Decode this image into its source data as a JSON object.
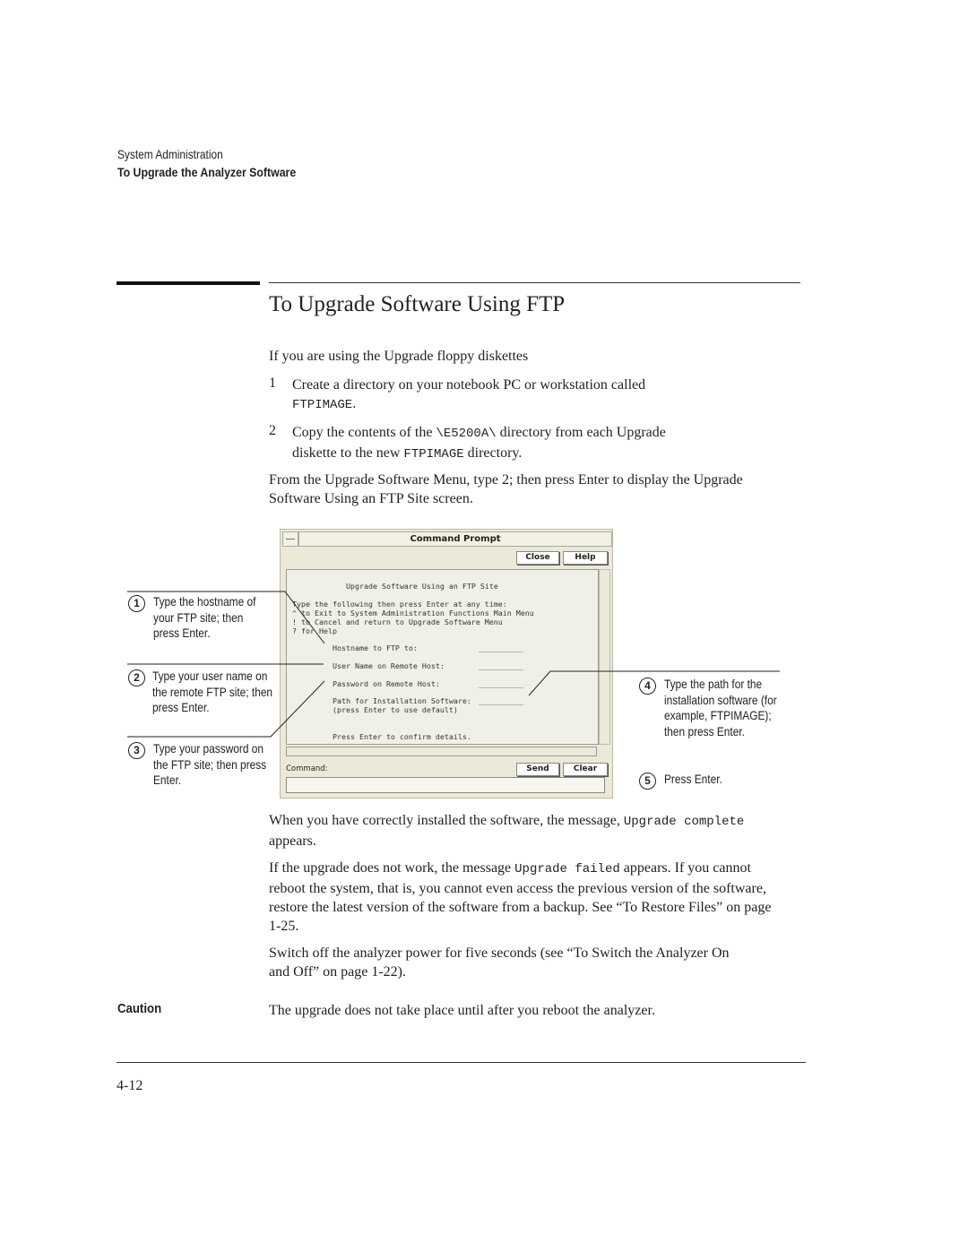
{
  "header": {
    "section": "System Administration",
    "subsection": "To Upgrade the Analyzer Software"
  },
  "title": "To Upgrade Software Using FTP",
  "intro": "If you are using the Upgrade floppy diskettes",
  "steps": [
    {
      "num": "1",
      "text_a": "Create a directory on your notebook PC or workstation called",
      "code": "FTPIMAGE",
      "text_b": "."
    },
    {
      "num": "2",
      "text_a": "Copy the contents of the ",
      "code": "\\E5200A\\",
      "text_b": " directory from each Upgrade",
      "text_c": "diskette to the new ",
      "code2": "FTPIMAGE",
      "text_d": " directory."
    }
  ],
  "para1": "From the Upgrade Software Menu, type 2; then press Enter to display the Upgrade Software Using an FTP Site screen.",
  "window": {
    "title": "Command Prompt",
    "close": "Close",
    "help": "Help",
    "heading": "Upgrade Software Using an FTP Site",
    "lines": [
      "Type the following then press Enter at any time:",
      "^ to Exit to System Administration Functions Main Menu",
      "! to Cancel and return to Upgrade Software Menu",
      "? for Help"
    ],
    "fields": [
      {
        "label": "Hostname to FTP to:",
        "value": "__________"
      },
      {
        "label": "User Name on Remote Host:",
        "value": "__________"
      },
      {
        "label": "Password on Remote Host:",
        "value": "__________"
      },
      {
        "label": "Path for Installation Software:",
        "value": "__________"
      }
    ],
    "default_note": "(press Enter to use default)",
    "confirm": "Press Enter to confirm details.",
    "command_label": "Command:",
    "send": "Send",
    "clear": "Clear",
    "command_value": ""
  },
  "callouts": [
    {
      "num": "1",
      "text": "Type the hostname of your FTP site; then press Enter."
    },
    {
      "num": "2",
      "text": "Type your user name on the remote FTP site; then press Enter."
    },
    {
      "num": "3",
      "text": "Type your password on the FTP site; then press Enter."
    },
    {
      "num": "4",
      "text": "Type the path for the installation software (for example, FTPIMAGE); then press Enter."
    },
    {
      "num": "5",
      "text": "Press Enter."
    }
  ],
  "para2_a": "When you have correctly installed the software, the message, ",
  "para2_code": "Upgrade complete",
  "para2_b": " appears.",
  "para3_a": "If the upgrade does not work, the message ",
  "para3_code": "Upgrade failed",
  "para3_b": " appears. If you cannot reboot the system, that is, you cannot even access the previous version of the software, restore the latest version of the software from a backup. See “To Restore Files” on page 1-25.",
  "para4": "Switch off the analyzer power for five seconds (see “To Switch the Analyzer On and Off” on page 1-22).",
  "caution_label": "Caution",
  "caution_text": "The upgrade does not take place until after you reboot the analyzer.",
  "page_number": "4-12"
}
